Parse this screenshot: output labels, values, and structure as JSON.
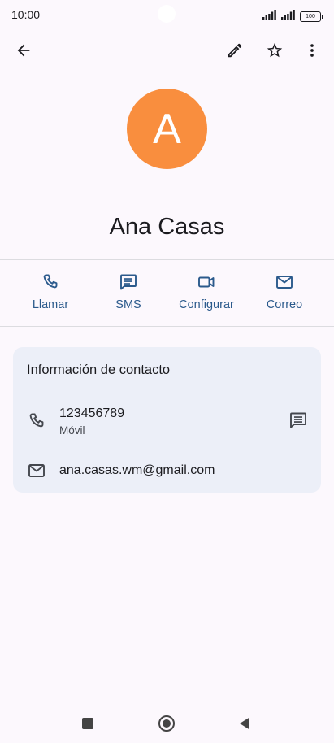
{
  "status_bar": {
    "time": "10:00",
    "battery": "100",
    "icons": [
      "signal-icon",
      "signal-icon",
      "battery-icon"
    ]
  },
  "top_bar": {
    "icons": [
      "back-arrow-icon",
      "pencil-icon",
      "star-outline-icon",
      "more-vert-icon"
    ]
  },
  "contact": {
    "initial": "A",
    "name": "Ana Casas",
    "avatar_color": "#f98e3e"
  },
  "actions": [
    {
      "label": "Llamar",
      "icon": "phone-icon"
    },
    {
      "label": "SMS",
      "icon": "message-icon"
    },
    {
      "label": "Configurar",
      "icon": "video-icon"
    },
    {
      "label": "Correo",
      "icon": "mail-icon"
    }
  ],
  "info_card": {
    "title": "Información de contacto",
    "phone": {
      "number": "123456789",
      "type": "Móvil"
    },
    "email": "ana.casas.wm@gmail.com"
  },
  "nav_bar": {
    "icons": [
      "recents-square-icon",
      "home-circle-icon",
      "back-triangle-icon"
    ]
  },
  "colors": {
    "accent": "#2b5a8c",
    "background": "#fcf8fd",
    "card": "#eceff8"
  }
}
